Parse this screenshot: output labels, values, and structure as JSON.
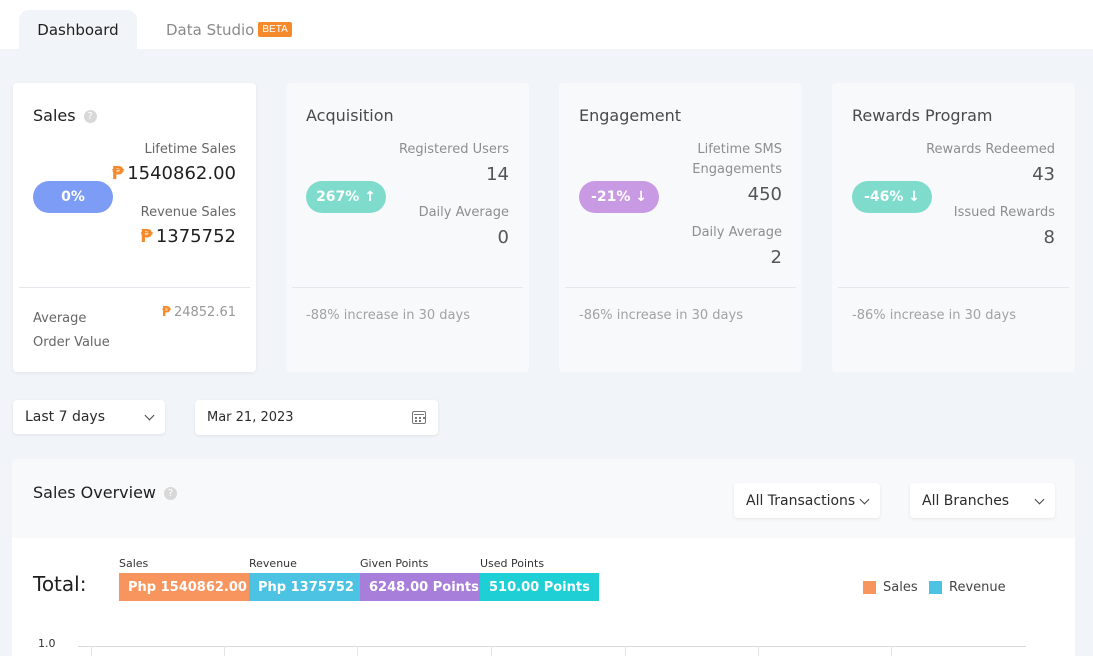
{
  "tabs": [
    {
      "label": "Dashboard"
    },
    {
      "label": "Data Studio",
      "badge": "BETA"
    }
  ],
  "cards": {
    "sales": {
      "title": "Sales",
      "pill": "0%",
      "pill_color": "#7c9cf5",
      "stats": [
        {
          "label": "Lifetime Sales",
          "value": "1540862.00",
          "currency": "₱"
        },
        {
          "label": "Revenue Sales",
          "value": "1375752",
          "currency": "₱"
        }
      ],
      "footer_label": "Average Order Value",
      "footer_value": "24852.61",
      "currency": "₱"
    },
    "acquisition": {
      "title": "Acquisition",
      "pill": "267% ↑",
      "pill_color": "#7fdccd",
      "stats": [
        {
          "label": "Registered Users",
          "value": "14"
        },
        {
          "label": "Daily Average",
          "value": "0"
        }
      ],
      "footer": "-88% increase in 30 days"
    },
    "engagement": {
      "title": "Engagement",
      "pill": "-21% ↓",
      "pill_color": "#c99ae4",
      "stats": [
        {
          "label": "Lifetime SMS Engagements",
          "value": "450"
        },
        {
          "label": "Daily Average",
          "value": "2"
        }
      ],
      "footer": "-86% increase in 30 days"
    },
    "rewards": {
      "title": "Rewards Program",
      "pill": "-46% ↓",
      "pill_color": "#7fdccd",
      "stats": [
        {
          "label": "Rewards Redeemed",
          "value": "43"
        },
        {
          "label": "Issued Rewards",
          "value": "8"
        }
      ],
      "footer": "-86% increase in 30 days"
    }
  },
  "filters": {
    "range": "Last 7 days",
    "date": "Mar 21, 2023"
  },
  "overview": {
    "title": "Sales Overview",
    "transactions_select": "All Transactions",
    "branches_select": "All Branches",
    "total_label": "Total:",
    "metrics": [
      {
        "label": "Sales",
        "value": "Php 1540862.00",
        "color": "#f8955e"
      },
      {
        "label": "Revenue",
        "value": "Php 1375752",
        "color": "#4dc3e3"
      },
      {
        "label": "Given Points",
        "value": "6248.00 Points",
        "color": "#a77fdb"
      },
      {
        "label": "Used Points",
        "value": "510.00 Points",
        "color": "#1ecfd6"
      }
    ],
    "legend": [
      {
        "label": "Sales",
        "color": "#f8955e"
      },
      {
        "label": "Revenue",
        "color": "#4dc3e3"
      }
    ],
    "y_tick": "1.0"
  }
}
